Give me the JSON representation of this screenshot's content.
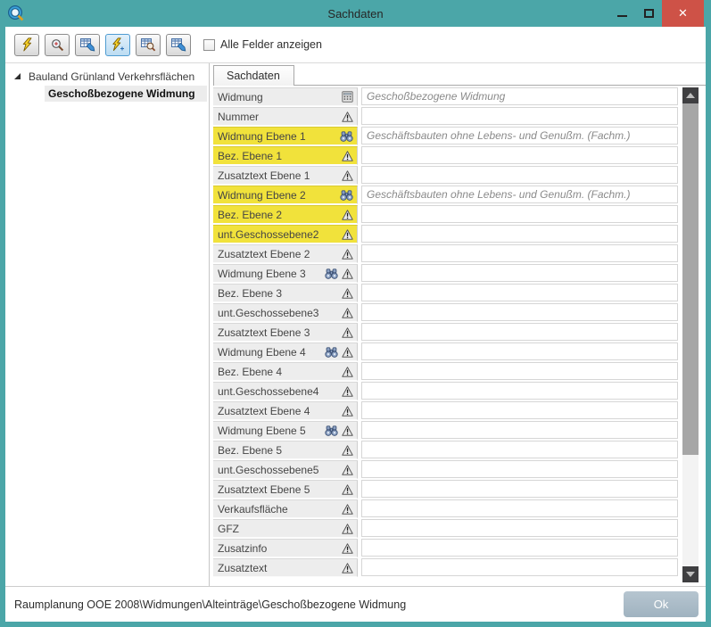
{
  "window": {
    "title": "Sachdaten",
    "accent_color": "#4ba6a8",
    "close_color": "#ce5247",
    "controls": [
      {
        "name": "minimize",
        "icon": "minimize-icon"
      },
      {
        "name": "maximize",
        "icon": "maximize-icon"
      },
      {
        "name": "close",
        "icon": "close-icon"
      }
    ]
  },
  "toolbar": {
    "buttons": [
      {
        "name": "identify-flash",
        "icon": "lightning",
        "active": false
      },
      {
        "name": "zoom-in",
        "icon": "magnifier-plus",
        "active": false
      },
      {
        "name": "edit-table",
        "icon": "table-edit",
        "active": false
      },
      {
        "name": "flash-auto",
        "icon": "lightning-sparkle",
        "active": true
      },
      {
        "name": "search-table",
        "icon": "table-search",
        "active": false
      },
      {
        "name": "edit-table-2",
        "icon": "table-edit",
        "active": false
      }
    ],
    "checkbox_label": "Alle Felder anzeigen",
    "checkbox_checked": false
  },
  "tree": {
    "root": "Bauland Grünland Verkehrsflächen",
    "selected_child": "Geschoßbezogene Widmung"
  },
  "tab": {
    "label": "Sachdaten"
  },
  "form": {
    "highlight_color": "#f1e23b",
    "rows": [
      {
        "label": "Widmung",
        "icons": [
          "calculator"
        ],
        "value": "Geschoßbezogene Widmung",
        "highlight": false
      },
      {
        "label": "Nummer",
        "icons": [
          "warning"
        ],
        "value": "",
        "highlight": false
      },
      {
        "label": "Widmung Ebene 1",
        "icons": [
          "binoculars"
        ],
        "value": "Geschäftsbauten ohne Lebens- und Genußm. (Fachm.)",
        "highlight": true
      },
      {
        "label": "Bez. Ebene 1",
        "icons": [
          "warning"
        ],
        "value": "",
        "highlight": true
      },
      {
        "label": "Zusatztext Ebene 1",
        "icons": [
          "warning"
        ],
        "value": "",
        "highlight": false
      },
      {
        "label": "Widmung Ebene 2",
        "icons": [
          "binoculars"
        ],
        "value": "Geschäftsbauten ohne Lebens- und Genußm. (Fachm.)",
        "highlight": true
      },
      {
        "label": "Bez. Ebene 2",
        "icons": [
          "warning"
        ],
        "value": "",
        "highlight": true
      },
      {
        "label": "unt.Geschossebene2",
        "icons": [
          "warning"
        ],
        "value": "",
        "highlight": true
      },
      {
        "label": "Zusatztext Ebene 2",
        "icons": [
          "warning"
        ],
        "value": "",
        "highlight": false
      },
      {
        "label": "Widmung Ebene 3",
        "icons": [
          "binoculars",
          "warning"
        ],
        "value": "",
        "highlight": false
      },
      {
        "label": "Bez. Ebene 3",
        "icons": [
          "warning"
        ],
        "value": "",
        "highlight": false
      },
      {
        "label": "unt.Geschossebene3",
        "icons": [
          "warning"
        ],
        "value": "",
        "highlight": false
      },
      {
        "label": "Zusatztext Ebene 3",
        "icons": [
          "warning"
        ],
        "value": "",
        "highlight": false
      },
      {
        "label": "Widmung Ebene 4",
        "icons": [
          "binoculars",
          "warning"
        ],
        "value": "",
        "highlight": false
      },
      {
        "label": "Bez. Ebene 4",
        "icons": [
          "warning"
        ],
        "value": "",
        "highlight": false
      },
      {
        "label": "unt.Geschossebene4",
        "icons": [
          "warning"
        ],
        "value": "",
        "highlight": false
      },
      {
        "label": "Zusatztext Ebene 4",
        "icons": [
          "warning"
        ],
        "value": "",
        "highlight": false
      },
      {
        "label": "Widmung Ebene 5",
        "icons": [
          "binoculars",
          "warning"
        ],
        "value": "",
        "highlight": false
      },
      {
        "label": "Bez. Ebene 5",
        "icons": [
          "warning"
        ],
        "value": "",
        "highlight": false
      },
      {
        "label": "unt.Geschossebene5",
        "icons": [
          "warning"
        ],
        "value": "",
        "highlight": false
      },
      {
        "label": "Zusatztext Ebene 5",
        "icons": [
          "warning"
        ],
        "value": "",
        "highlight": false
      },
      {
        "label": "Verkaufsfläche",
        "icons": [
          "warning"
        ],
        "value": "",
        "highlight": false
      },
      {
        "label": "GFZ",
        "icons": [
          "warning"
        ],
        "value": "",
        "highlight": false
      },
      {
        "label": "Zusatzinfo",
        "icons": [
          "warning"
        ],
        "value": "",
        "highlight": false
      },
      {
        "label": "Zusatztext",
        "icons": [
          "warning"
        ],
        "value": "",
        "highlight": false
      }
    ]
  },
  "statusbar": {
    "path": "Raumplanung OOE 2008\\Widmungen\\Alteinträge\\Geschoßbezogene Widmung",
    "ok_label": "Ok"
  }
}
